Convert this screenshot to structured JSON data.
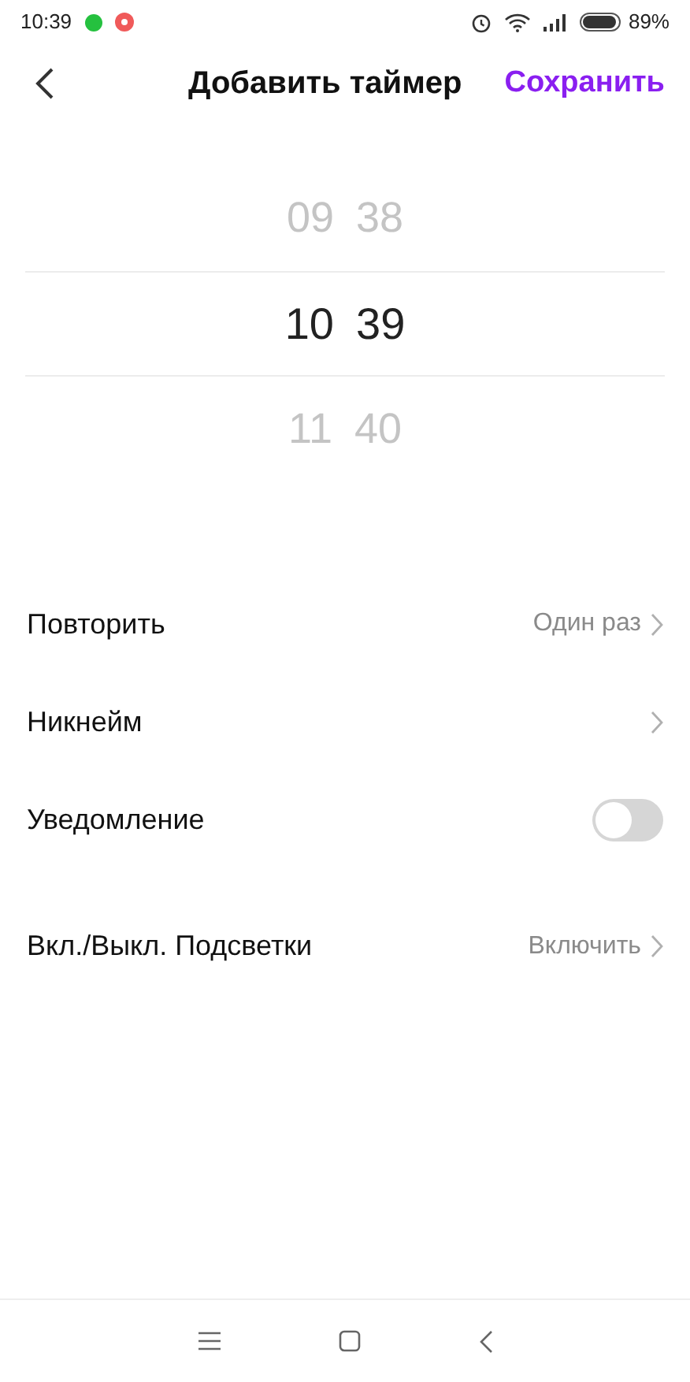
{
  "status_bar": {
    "time": "10:39",
    "battery": "89%"
  },
  "header": {
    "title": "Добавить таймер",
    "save": "Сохранить"
  },
  "picker": [
    {
      "hour": "09",
      "minute": "38",
      "selected": false
    },
    {
      "hour": "10",
      "minute": "39",
      "selected": true
    },
    {
      "hour": "11",
      "minute": "40",
      "selected": false
    }
  ],
  "settings": [
    {
      "kind": "link",
      "label": "Повторить",
      "value": "Один раз"
    },
    {
      "kind": "link",
      "label": "Никнейм"
    },
    {
      "kind": "switch",
      "label": "Уведомление",
      "on": false
    },
    {
      "kind": "link",
      "label": "Вкл./Выкл. Подсветки",
      "value": "Включить"
    }
  ]
}
